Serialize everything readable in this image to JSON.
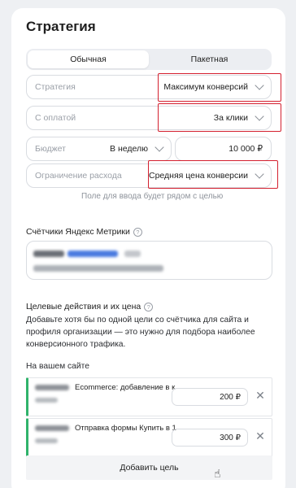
{
  "title": "Стратегия",
  "tabs": [
    {
      "label": "Обычная",
      "active": true
    },
    {
      "label": "Пакетная",
      "active": false
    }
  ],
  "fields": {
    "strategy": {
      "placeholder": "Стратегия",
      "value": "Максимум конверсий"
    },
    "payment": {
      "placeholder": "С оплатой",
      "value": "За клики"
    },
    "budget": {
      "placeholder": "Бюджет",
      "period": "В неделю",
      "amount": "10 000 ₽"
    },
    "limit": {
      "placeholder": "Ограничение расхода",
      "value": "Средняя цена конверсии"
    }
  },
  "hint": "Поле для ввода будет рядом с целью",
  "metrika": {
    "title": "Счётчики Яндекс Метрики",
    "help_icon": "question-circle-icon"
  },
  "goals": {
    "title": "Целевые действия и их цена",
    "description": "Добавьте хотя бы по одной цели со счётчика для сайта и профиля организации — это нужно для подбора наиболее конверсионного трафика.",
    "on_site_label": "На вашем сайте",
    "items": [
      {
        "name": "Ecommerce: добавление в к",
        "price": "200 ₽"
      },
      {
        "name": "Отправка формы Купить в 1",
        "price": "300 ₽"
      }
    ],
    "add_label": "Добавить цель"
  },
  "colors": {
    "highlight": "#d4202f",
    "goal_accent": "#2fb36b",
    "link_blur": "#4a7be0"
  }
}
